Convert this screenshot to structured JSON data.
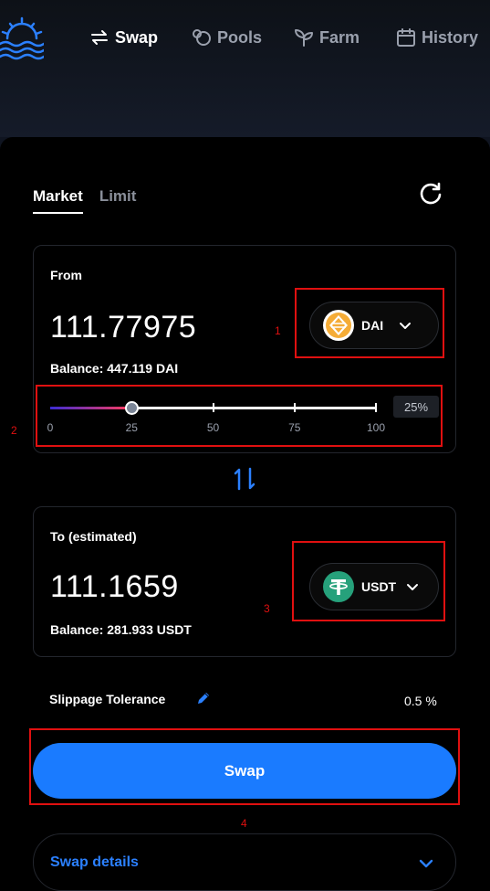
{
  "nav": {
    "swap": "Swap",
    "pools": "Pools",
    "farm": "Farm",
    "history": "History"
  },
  "tabs": {
    "market": "Market",
    "limit": "Limit"
  },
  "from": {
    "label": "From",
    "amount": "111.77975",
    "balance": "Balance: 447.119 DAI",
    "token": "DAI"
  },
  "slider": {
    "value_percent": 25,
    "percent_label": "25%",
    "ticks": [
      "0",
      "25",
      "50",
      "75",
      "100"
    ]
  },
  "to": {
    "label": "To (estimated)",
    "amount": "111.1659",
    "balance": "Balance: 281.933 USDT",
    "token": "USDT"
  },
  "slippage": {
    "label": "Slippage Tolerance",
    "value": "0.5 %"
  },
  "swap_button": "Swap",
  "swap_details": "Swap details",
  "annotations": [
    "1",
    "2",
    "3",
    "4"
  ],
  "colors": {
    "accent": "#1a7bff",
    "dai": "#f5ac37",
    "usdt": "#26a17b",
    "annotation": "#e01010"
  }
}
